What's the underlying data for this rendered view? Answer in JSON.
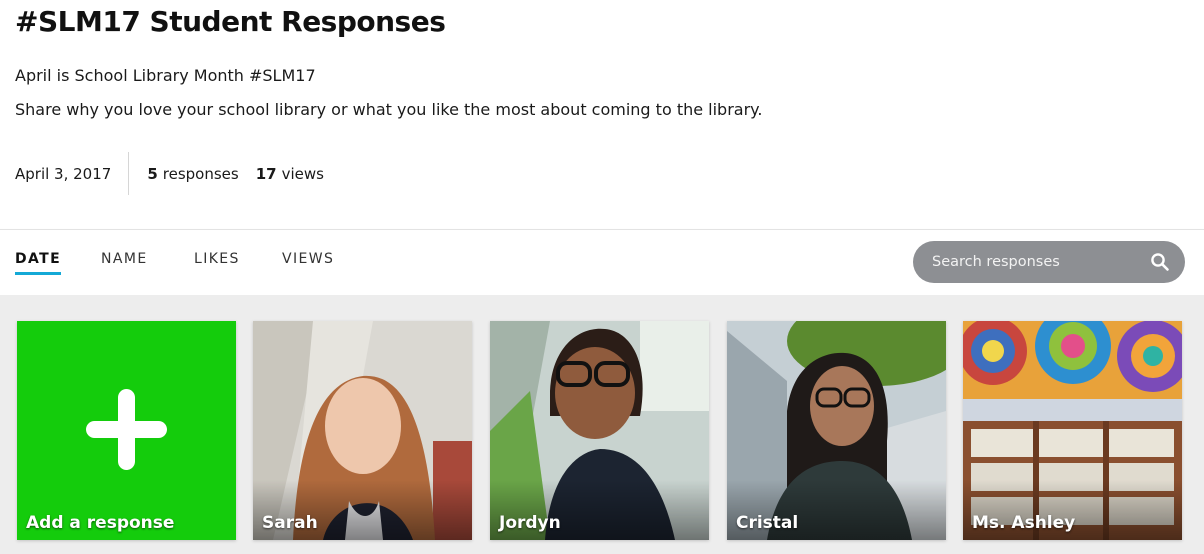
{
  "header": {
    "title": "#SLM17 Student Responses",
    "description_line1": "April is School Library Month #SLM17",
    "description_line2": "Share why you love your school library or what you like the most about coming to the library.",
    "date": "April 3, 2017",
    "responses_count": "5",
    "responses_label": "responses",
    "views_count": "17",
    "views_label": "views"
  },
  "tabs": [
    {
      "label": "DATE",
      "active": true
    },
    {
      "label": "NAME",
      "active": false
    },
    {
      "label": "LIKES",
      "active": false
    },
    {
      "label": "VIEWS",
      "active": false
    }
  ],
  "search": {
    "placeholder": "Search responses",
    "icon": "search-icon"
  },
  "add_card": {
    "label": "Add a response",
    "icon": "plus-icon",
    "color": "#14cc0c"
  },
  "responses": [
    {
      "name": "Sarah"
    },
    {
      "name": "Jordyn"
    },
    {
      "name": "Cristal"
    },
    {
      "name": "Ms. Ashley"
    }
  ],
  "colors": {
    "accent": "#14a9d6",
    "add_green": "#14cc0c",
    "search_bg": "#8d8f93"
  }
}
